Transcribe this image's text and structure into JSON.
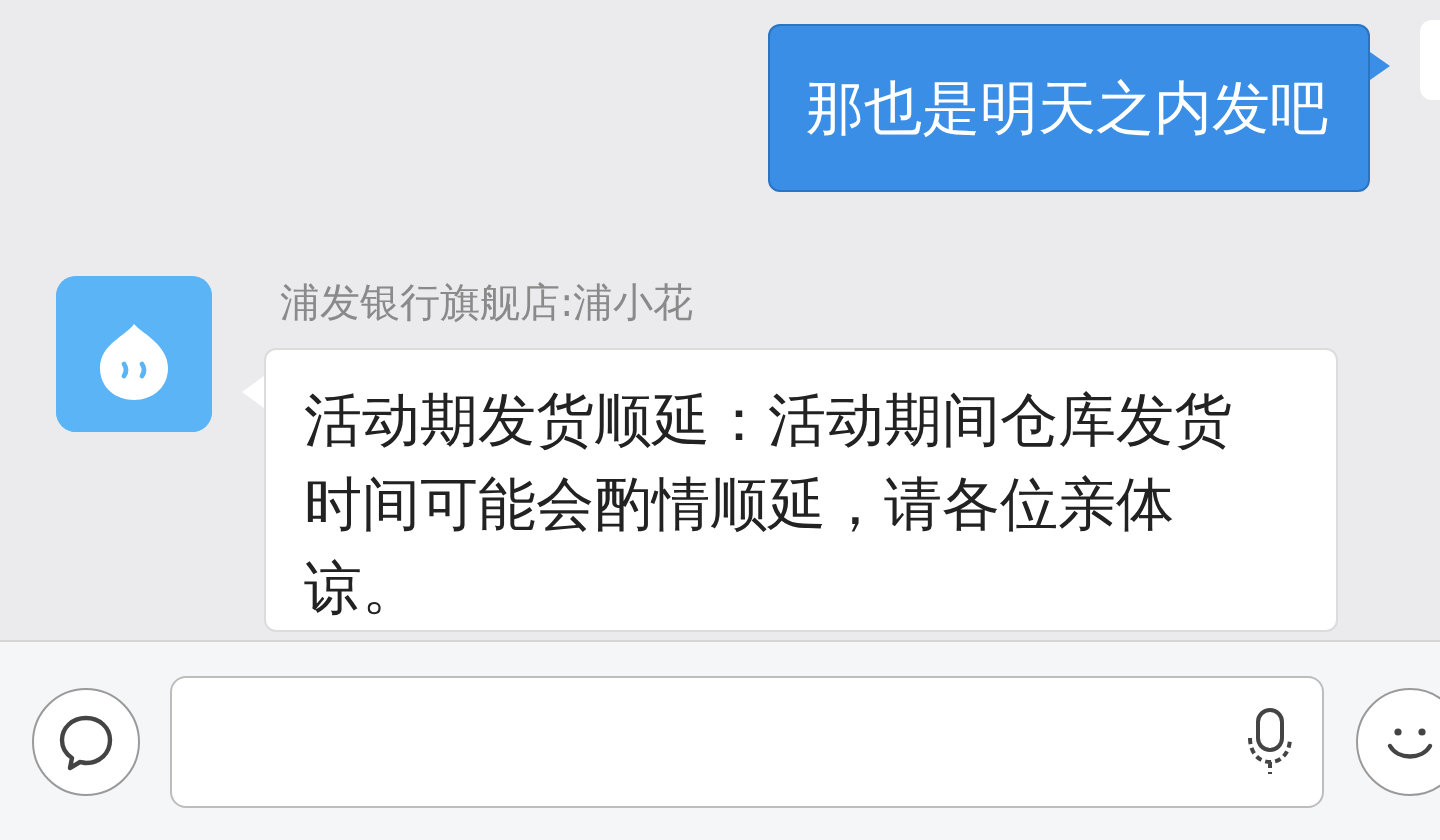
{
  "messages": [
    {
      "kind": "outgoing",
      "text": "那也是明天之内发吧"
    },
    {
      "kind": "incoming",
      "sender": "浦发银行旗舰店:浦小花",
      "text": "活动期发货顺延：活动期间仓库发货时间可能会酌情顺延，请各位亲体谅。"
    }
  ]
}
